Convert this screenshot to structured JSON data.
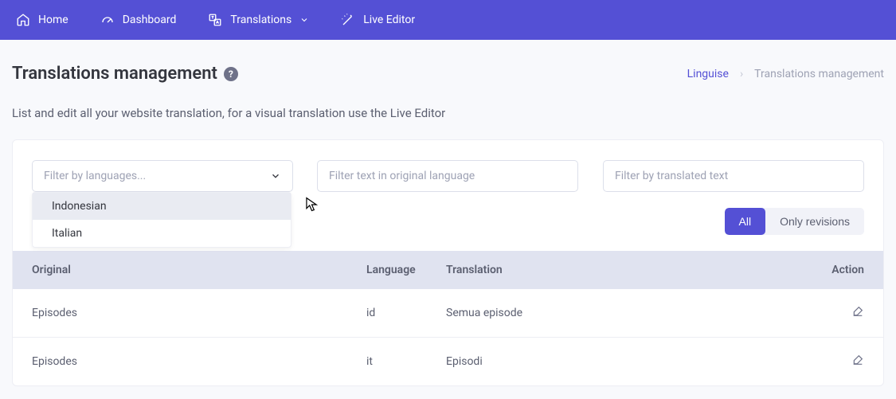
{
  "nav": {
    "home": "Home",
    "dashboard": "Dashboard",
    "translations": "Translations",
    "live_editor": "Live Editor"
  },
  "title": "Translations management",
  "breadcrumb": {
    "link": "Linguise",
    "sep": "›",
    "current": "Translations management"
  },
  "subtitle": "List and edit all your website translation, for a visual translation use the Live Editor",
  "filters": {
    "lang_placeholder": "Filter by languages...",
    "orig_placeholder": "Filter text in original language",
    "trans_placeholder": "Filter by translated text"
  },
  "dropdown": {
    "opt0": "Indonesian",
    "opt1": "Italian"
  },
  "toggle": {
    "all": "All",
    "revisions": "Only revisions"
  },
  "table": {
    "head_original": "Original",
    "head_language": "Language",
    "head_translation": "Translation",
    "head_action": "Action",
    "rows": [
      {
        "original": "Episodes",
        "language": "id",
        "translation": "Semua episode"
      },
      {
        "original": "Episodes",
        "language": "it",
        "translation": "Episodi"
      }
    ]
  }
}
